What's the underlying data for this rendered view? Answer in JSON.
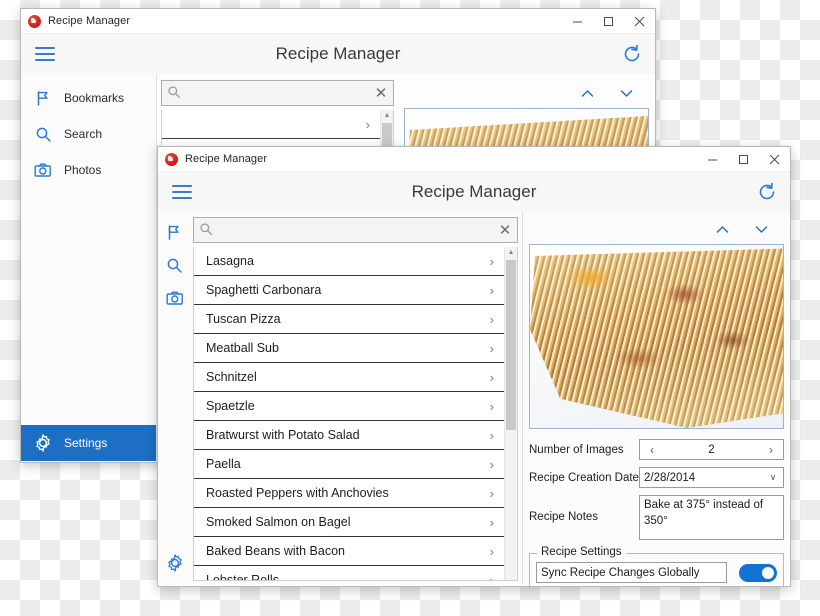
{
  "back_window": {
    "titlebar": {
      "app_name": "Recipe Manager",
      "minimize": "—",
      "maximize": "□",
      "close": "✕"
    },
    "header": {
      "title": "Recipe Manager",
      "menu_icon": "hamburger-icon",
      "refresh_icon": "refresh-icon"
    },
    "nav": {
      "items": [
        {
          "label": "Bookmarks",
          "icon": "flag-icon",
          "selected": false
        },
        {
          "label": "Search",
          "icon": "search-icon",
          "selected": false
        },
        {
          "label": "Photos",
          "icon": "camera-icon",
          "selected": false
        }
      ],
      "settings": {
        "label": "Settings",
        "icon": "gear-icon",
        "selected": true
      }
    },
    "search": {
      "value": "",
      "placeholder": "",
      "clear_label": "✕"
    },
    "list": {
      "chevron": "›",
      "rows": [
        "",
        "",
        ""
      ]
    },
    "image_nav": {
      "up": "chevron-up-icon",
      "down": "chevron-down-icon"
    }
  },
  "front_window": {
    "titlebar": {
      "app_name": "Recipe Manager",
      "minimize": "—",
      "maximize": "□",
      "close": "✕"
    },
    "header": {
      "title": "Recipe Manager",
      "menu_icon": "hamburger-icon",
      "refresh_icon": "refresh-icon"
    },
    "rail": {
      "items": [
        {
          "icon": "flag-icon"
        },
        {
          "icon": "search-icon"
        },
        {
          "icon": "camera-icon"
        }
      ],
      "settings_icon": "gear-icon"
    },
    "search": {
      "value": "",
      "placeholder": "",
      "clear_label": "✕"
    },
    "list": {
      "chevron": "›",
      "recipes": [
        "Lasagna",
        "Spaghetti Carbonara",
        "Tuscan Pizza",
        "Meatball Sub",
        "Schnitzel",
        "Spaetzle",
        "Bratwurst with Potato Salad",
        "Paella",
        "Roasted Peppers with Anchovies",
        "Smoked Salmon on Bagel",
        "Baked Beans with Bacon",
        "Lobster Rolls"
      ]
    },
    "image_nav": {
      "up": "chevron-up-icon",
      "down": "chevron-down-icon"
    },
    "detail": {
      "number_of_images": {
        "label": "Number of Images",
        "value": "2",
        "decrement": "‹",
        "increment": "›"
      },
      "creation_date": {
        "label": "Recipe Creation Date",
        "value": "2/28/2014",
        "arrow": "∨"
      },
      "notes": {
        "label": "Recipe Notes",
        "value": "Bake at 375° instead of 350°"
      },
      "settings_group": {
        "legend": "Recipe Settings",
        "sync_label": "Sync Recipe Changes Globally",
        "toggle_on": true
      }
    }
  },
  "colors": {
    "accent_blue": "#1d6fc4",
    "icon_blue": "#2a7bd1",
    "toggle_blue": "#1273d4",
    "app_icon_red": "#cf1f1a"
  }
}
